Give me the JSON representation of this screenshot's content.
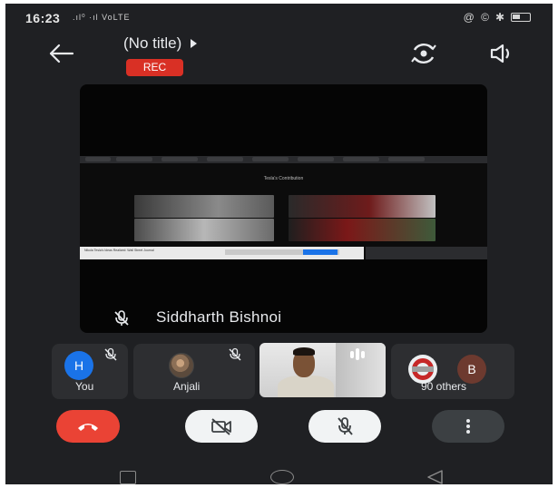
{
  "status_bar": {
    "time": "16:23",
    "network": ".ıl⁰ ·ıl VoLTE",
    "right_icons": [
      "alarm-icon",
      "clock-icon",
      "bluetooth-icon",
      "battery-icon"
    ],
    "right_text": "@ ©"
  },
  "header": {
    "title": "(No title)",
    "rec_label": "REC",
    "icons": [
      "back-arrow-icon",
      "switch-camera-icon",
      "speaker-icon",
      "chevron-right-icon"
    ]
  },
  "main_tile": {
    "presenter_name": "Siddharth Bishnoi",
    "shared_screen_heading": "Tesla's Contribution",
    "shared_screen_strip_text": "Nikola Tesla's Ideas Realized: Wall Street Journal"
  },
  "participants": [
    {
      "label": "You",
      "initial": "H",
      "muted": true
    },
    {
      "label": "Anjali",
      "muted": true
    },
    {
      "label": "",
      "type": "self-video"
    },
    {
      "label": "90 others",
      "initial": "B"
    }
  ],
  "controls": {
    "end_call": "end-call-icon",
    "camera": "camera-off-icon",
    "mic": "mic-off-icon",
    "more": "more-vert-icon"
  },
  "colors": {
    "background": "#1f2023",
    "rec": "#d93025",
    "end_call": "#ea4335",
    "avatar_h": "#1a73e8",
    "avatar_b": "#6d3a2f"
  }
}
